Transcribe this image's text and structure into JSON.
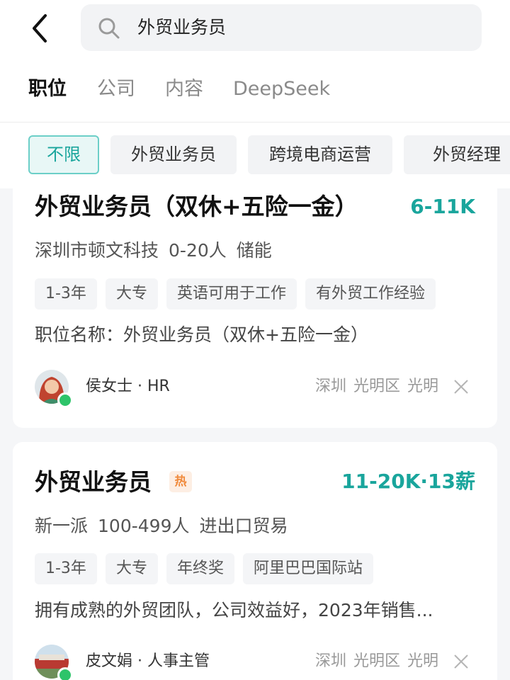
{
  "search": {
    "query": "外贸业务员"
  },
  "tabs": [
    {
      "label": "职位",
      "active": true
    },
    {
      "label": "公司",
      "active": false
    },
    {
      "label": "内容",
      "active": false
    },
    {
      "label": "DeepSeek",
      "active": false
    }
  ],
  "filters": [
    {
      "label": "不限",
      "active": true
    },
    {
      "label": "外贸业务员",
      "active": false
    },
    {
      "label": "跨境电商运营",
      "active": false
    },
    {
      "label": "外贸经理",
      "active": false
    }
  ],
  "jobs": [
    {
      "title": "外贸业务员（双休+五险一金）",
      "salary": "6-11K",
      "company": {
        "name": "深圳市顿文科技",
        "size": "0-20人",
        "industry": "储能"
      },
      "tags": [
        "1-3年",
        "大专",
        "英语可用于工作",
        "有外贸工作经验"
      ],
      "description": "职位名称：外贸业务员（双休+五险一金）",
      "recruiter": "侯女士 · HR",
      "location": [
        "深圳",
        "光明区",
        "光明"
      ]
    },
    {
      "title": "外贸业务员",
      "badge": "热",
      "salary": "11-20K·13薪",
      "company": {
        "name": "新一派",
        "size": "100-499人",
        "industry": "进出口贸易"
      },
      "tags": [
        "1-3年",
        "大专",
        "年终奖",
        "阿里巴巴国际站"
      ],
      "description": "拥有成熟的外贸团队，公司效益好，2023年销售...",
      "recruiter": "皮文娟 · 人事主管",
      "location": [
        "深圳",
        "光明区",
        "光明"
      ]
    }
  ],
  "colors": {
    "accent": "#19a59c",
    "hot": "#f08a3c",
    "online": "#2ec46a"
  }
}
